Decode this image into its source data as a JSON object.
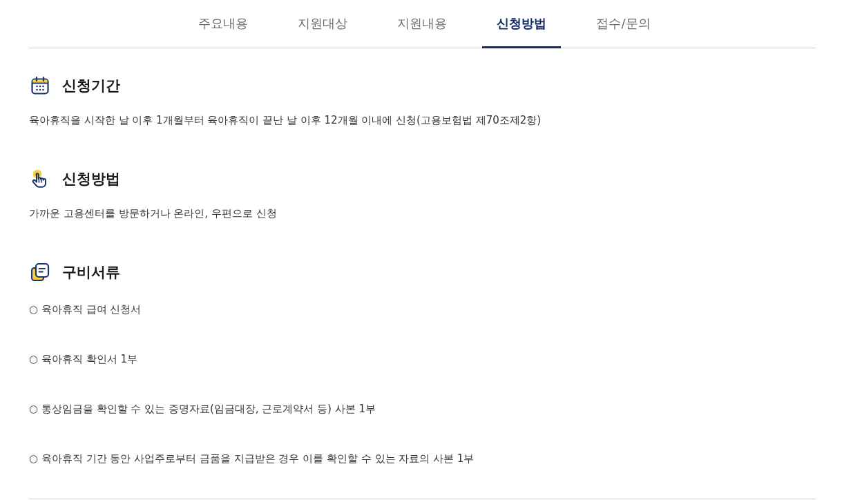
{
  "tabs": [
    {
      "label": "주요내용",
      "selected": false
    },
    {
      "label": "지원대상",
      "selected": false
    },
    {
      "label": "지원내용",
      "selected": false
    },
    {
      "label": "신청방법",
      "selected": true
    },
    {
      "label": "접수/문의",
      "selected": false
    }
  ],
  "application_period": {
    "title": "신청기간",
    "text": "육아휴직을 시작한 날 이후 1개월부터 육아휴직이 끝난 날 이후 12개월 이내에 신청(고용보험법 제70조제2항)"
  },
  "application_method": {
    "title": "신청방법",
    "text": "가까운 고용센터를 방문하거나 온라인, 우편으로 신청"
  },
  "required_documents": {
    "title": "구비서류",
    "items": [
      "○ 육아휴직 급여 신청서",
      "○ 육아휴직 확인서 1부",
      "○ 통상임금을 확인할 수 있는 증명자료(임금대장, 근로계약서 등) 사본 1부",
      "○ 육아휴직 기간 동안 사업주로부터 금품을 지급받은 경우 이를 확인할 수 있는 자료의 사본 1부"
    ]
  }
}
